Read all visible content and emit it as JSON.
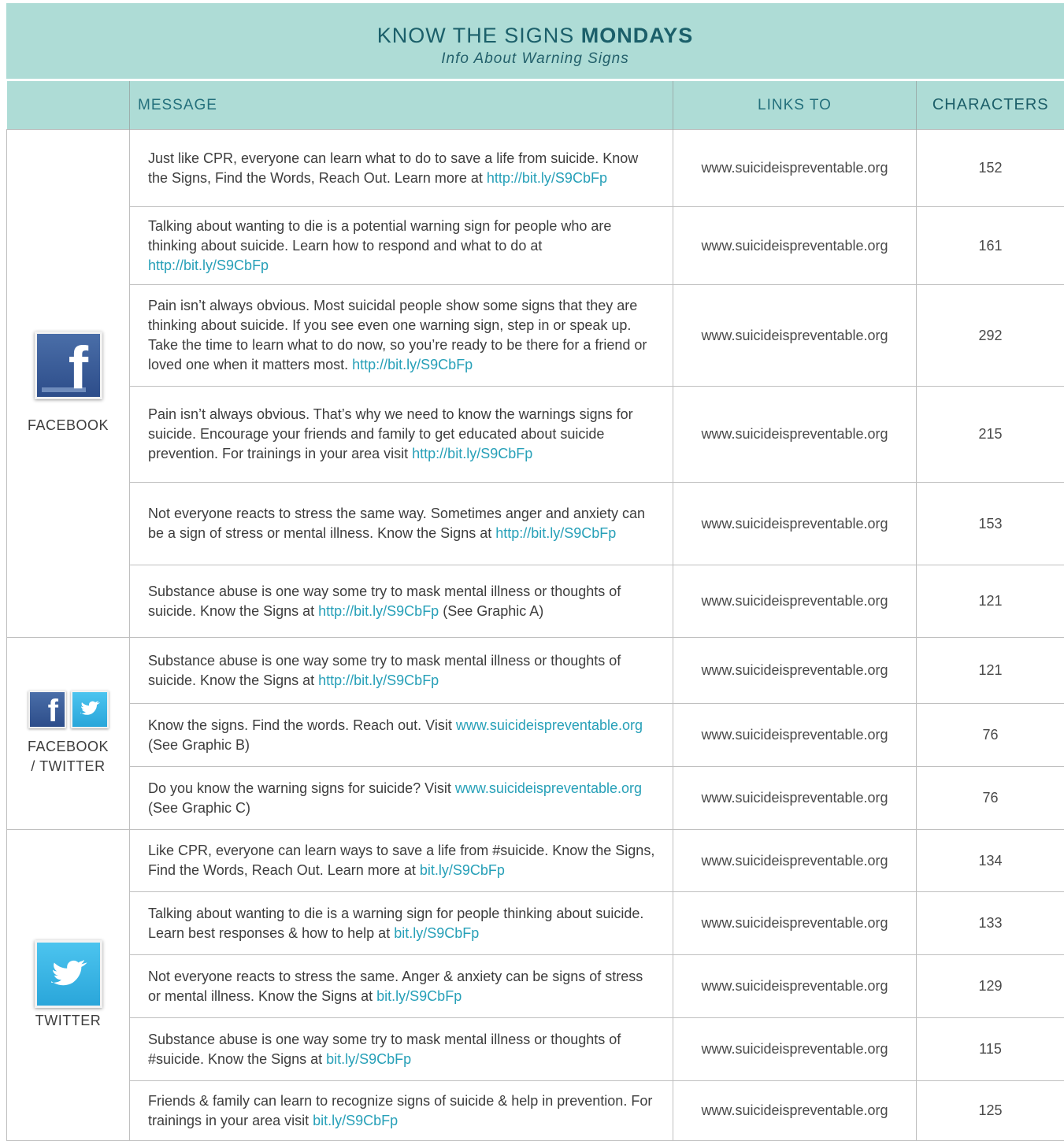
{
  "banner": {
    "title_light": "KNOW THE SIGNS",
    "title_bold": "MONDAYS",
    "subtitle": "Info About Warning Signs"
  },
  "columns": {
    "message": "MESSAGE",
    "links_to": "LINKS TO",
    "characters": "CHARACTERS"
  },
  "groups": [
    {
      "platform": "FACEBOOK",
      "icon": "facebook-icon",
      "rows": [
        {
          "text": "Just like CPR, everyone can learn what to do to save a life from suicide. Know the Signs, Find the Words, Reach Out. Learn more at ",
          "url": "http://bit.ly/S9CbFp",
          "after": "",
          "link": "www.suicideispreventable.org",
          "chars": "152"
        },
        {
          "text": "Talking about wanting to die is a potential warning sign for people who are thinking about suicide. Learn how to respond and what to do at ",
          "url": "http://bit.ly/S9CbFp",
          "after": "",
          "link": "www.suicideispreventable.org",
          "chars": "161"
        },
        {
          "text": "Pain isn’t always obvious. Most suicidal people show some signs that they are thinking about suicide. If you see even one warning sign, step in or speak up. Take the time to learn what to do now, so you’re ready to be there for a friend or loved one when it matters most. ",
          "url": "http://bit.ly/S9CbFp",
          "after": "",
          "link": "www.suicideispreventable.org",
          "chars": "292"
        },
        {
          "text": "Pain isn’t always obvious. That’s why we need to know the warnings signs for suicide. Encourage your friends and family to get educated about suicide prevention. For trainings in your area visit ",
          "url": "http://bit.ly/S9CbFp",
          "after": "",
          "link": "www.suicideispreventable.org",
          "chars": "215"
        },
        {
          "text": "Not everyone reacts to stress the same way. Sometimes anger and anxiety can be a sign of stress or mental illness. Know the Signs at ",
          "url": "http://bit.ly/S9CbFp",
          "after": "",
          "link": "www.suicideispreventable.org",
          "chars": "153"
        },
        {
          "text": "Substance abuse is one way some try to mask mental illness or thoughts of suicide. Know the Signs at ",
          "url": "http://bit.ly/S9CbFp",
          "after": " (See Graphic A)",
          "link": "www.suicideispreventable.org",
          "chars": "121"
        }
      ]
    },
    {
      "platform_line1": "FACEBOOK",
      "platform_line2": "/ TWITTER",
      "icon": "facebook-twitter-icons",
      "rows": [
        {
          "text": "Substance abuse is one way some try to mask mental illness or thoughts of suicide. Know the Signs at ",
          "url": "http://bit.ly/S9CbFp",
          "after": "",
          "link": "www.suicideispreventable.org",
          "chars": "121"
        },
        {
          "text": "Know the signs. Find the words. Reach out. Visit ",
          "url": "www.suicideispreventable.org",
          "after": " (See Graphic B)",
          "link": "www.suicideispreventable.org",
          "chars": "76"
        },
        {
          "text": "Do you know the warning signs for suicide? Visit ",
          "url": "www.suicideispreventable.org",
          "after": " (See Graphic C)",
          "link": "www.suicideispreventable.org",
          "chars": "76"
        }
      ]
    },
    {
      "platform": "TWITTER",
      "icon": "twitter-icon",
      "rows": [
        {
          "text": "Like CPR, everyone can learn ways to save a life from #suicide. Know the Signs, Find the Words, Reach Out. Learn more at ",
          "url": "bit.ly/S9CbFp",
          "after": "",
          "link": "www.suicideispreventable.org",
          "chars": "134"
        },
        {
          "text": "Talking about wanting to die is a warning sign for people thinking about suicide. Learn best responses & how to help at ",
          "url": "bit.ly/S9CbFp",
          "after": "",
          "link": "www.suicideispreventable.org",
          "chars": "133"
        },
        {
          "text": "Not everyone reacts to stress the same. Anger & anxiety can be signs of stress or mental illness. Know the Signs at ",
          "url": "bit.ly/S9CbFp",
          "after": "",
          "link": "www.suicideispreventable.org",
          "chars": "129"
        },
        {
          "text": "Substance abuse is one way some try to mask mental illness or thoughts of #suicide. Know the Signs at ",
          "url": "bit.ly/S9CbFp",
          "after": "",
          "link": "www.suicideispreventable.org",
          "chars": "115"
        },
        {
          "text": "Friends & family can learn to recognize signs of suicide & help in prevention. For trainings in your area visit ",
          "url": "bit.ly/S9CbFp",
          "after": "",
          "link": "www.suicideispreventable.org",
          "chars": "125"
        }
      ]
    }
  ]
}
